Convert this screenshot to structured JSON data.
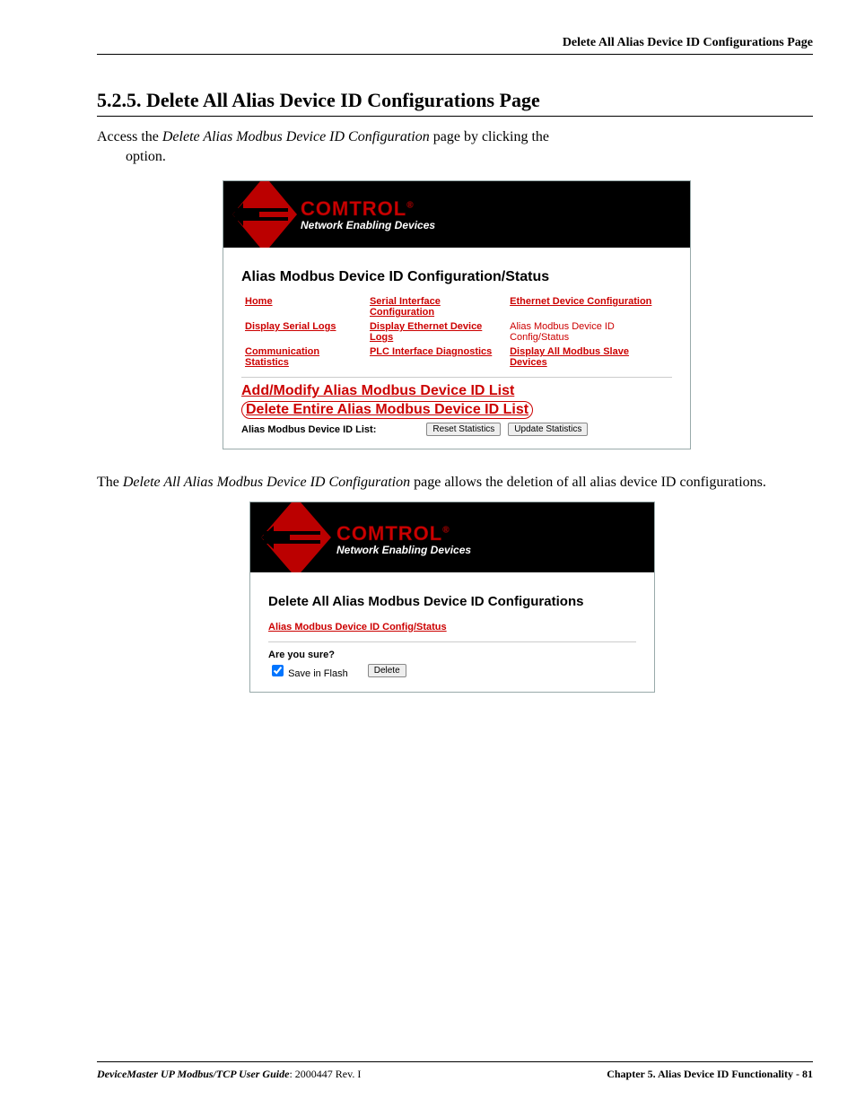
{
  "header": {
    "running_title": "Delete All Alias Device ID Configurations Page"
  },
  "section": {
    "number_title": "5.2.5. Delete All Alias Device ID Configurations Page",
    "intro_pre": "Access the ",
    "intro_em": "Delete Alias Modbus Device ID Configuration",
    "intro_post": " page by clicking the",
    "intro_line2": "option.",
    "para2_pre": "The ",
    "para2_em": "Delete All Alias Modbus Device ID Configuration",
    "para2_post": " page allows the deletion of all alias device ID configurations."
  },
  "shot1": {
    "brand": "COMTROL",
    "reg": "®",
    "tagline": "Network Enabling Devices",
    "title": "Alias Modbus Device ID Configuration/Status",
    "nav": {
      "home": "Home",
      "serial_iface": "Serial Interface Configuration",
      "eth_dev_cfg": "Ethernet Device Configuration",
      "disp_serial_logs": "Display Serial Logs",
      "disp_eth_logs": "Display Ethernet Device Logs",
      "alias_cfg_status": "Alias Modbus Device ID Config/Status",
      "comm_stats": "Communication Statistics",
      "plc_diag": "PLC Interface Diagnostics",
      "disp_all_slave": "Display All Modbus Slave Devices",
      "add_modify": "Add/Modify Alias Modbus Device ID List",
      "delete_entire": "Delete Entire Alias Modbus Device ID List"
    },
    "list_label": "Alias Modbus Device ID List:",
    "btn_reset": "Reset Statistics",
    "btn_update": "Update Statistics"
  },
  "shot2": {
    "brand": "COMTROL",
    "reg": "®",
    "tagline": "Network Enabling Devices",
    "title": "Delete All Alias Modbus Device ID Configurations",
    "back_link": "Alias Modbus Device ID Config/Status",
    "prompt": "Are you sure?",
    "save_label": "Save in Flash",
    "btn_delete": "Delete"
  },
  "footer": {
    "left_em": "DeviceMaster UP Modbus/TCP User Guide",
    "left_rest": ": 2000447 Rev. I",
    "right": "Chapter 5. Alias Device ID Functionality - 81"
  }
}
